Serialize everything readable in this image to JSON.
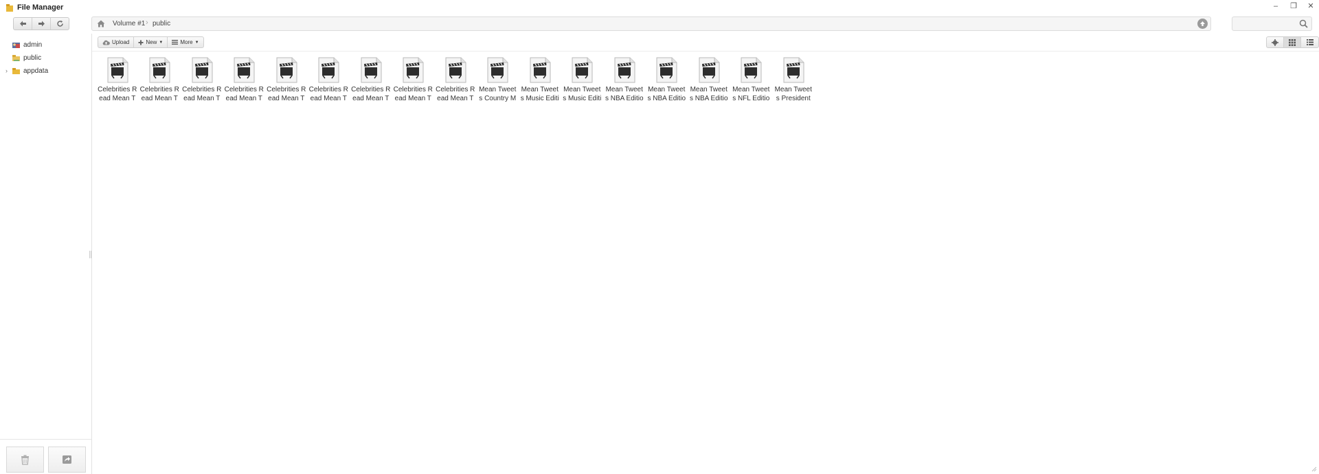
{
  "window": {
    "title": "File Manager",
    "controls": {
      "minimize": "–",
      "maximize": "❐",
      "close": "✕"
    }
  },
  "nav": {
    "back_icon": "back-arrow-icon",
    "forward_icon": "forward-arrow-icon",
    "refresh_icon": "refresh-icon"
  },
  "address": {
    "home_icon": "home-icon",
    "breadcrumbs": [
      "Volume #1",
      "public"
    ],
    "go_icon": "up-circle-icon"
  },
  "search": {
    "placeholder": "",
    "icon": "search-icon"
  },
  "sidebar": {
    "items": [
      {
        "label": "admin",
        "icon": "user-folder-icon",
        "expandable": false
      },
      {
        "label": "public",
        "icon": "shared-folder-icon",
        "expandable": false
      },
      {
        "label": "appdata",
        "icon": "folder-icon",
        "expandable": true
      }
    ],
    "footer": {
      "trash_icon": "trash-icon",
      "share_icon": "share-icon"
    }
  },
  "toolbar": {
    "upload_label": "Upload",
    "new_label": "New",
    "more_label": "More",
    "settings_icon": "gear-icon",
    "grid_view_icon": "grid-view-icon",
    "list_view_icon": "list-view-icon"
  },
  "files": [
    {
      "name": "Celebrities Read Mean T",
      "line1": "Celebrities R",
      "line2": "ead Mean T"
    },
    {
      "name": "Celebrities Read Mean T",
      "line1": "Celebrities R",
      "line2": "ead Mean T"
    },
    {
      "name": "Celebrities Read Mean T",
      "line1": "Celebrities R",
      "line2": "ead Mean T"
    },
    {
      "name": "Celebrities Read Mean T",
      "line1": "Celebrities R",
      "line2": "ead Mean T"
    },
    {
      "name": "Celebrities Read Mean T",
      "line1": "Celebrities R",
      "line2": "ead Mean T"
    },
    {
      "name": "Celebrities Read Mean T",
      "line1": "Celebrities R",
      "line2": "ead Mean T"
    },
    {
      "name": "Celebrities Read Mean T",
      "line1": "Celebrities R",
      "line2": "ead Mean T"
    },
    {
      "name": "Celebrities Read Mean T",
      "line1": "Celebrities R",
      "line2": "ead Mean T"
    },
    {
      "name": "Celebrities Read Mean T",
      "line1": "Celebrities R",
      "line2": "ead Mean T"
    },
    {
      "name": "Mean Tweets Country M",
      "line1": "Mean Tweet",
      "line2": "s Country M"
    },
    {
      "name": "Mean Tweets Music Editi",
      "line1": "Mean Tweet",
      "line2": "s Music Editi"
    },
    {
      "name": "Mean Tweets Music Editi",
      "line1": "Mean Tweet",
      "line2": "s Music Editi"
    },
    {
      "name": "Mean Tweets NBA Editio",
      "line1": "Mean Tweet",
      "line2": "s NBA Editio"
    },
    {
      "name": "Mean Tweets NBA Editio",
      "line1": "Mean Tweet",
      "line2": "s NBA Editio"
    },
    {
      "name": "Mean Tweets NBA Editio",
      "line1": "Mean Tweet",
      "line2": "s NBA Editio"
    },
    {
      "name": "Mean Tweets NFL Editio",
      "line1": "Mean Tweet",
      "line2": "s NFL Editio"
    },
    {
      "name": "Mean Tweets President",
      "line1": "Mean Tweet",
      "line2": "s President"
    }
  ],
  "file_icon": "video-file-icon"
}
